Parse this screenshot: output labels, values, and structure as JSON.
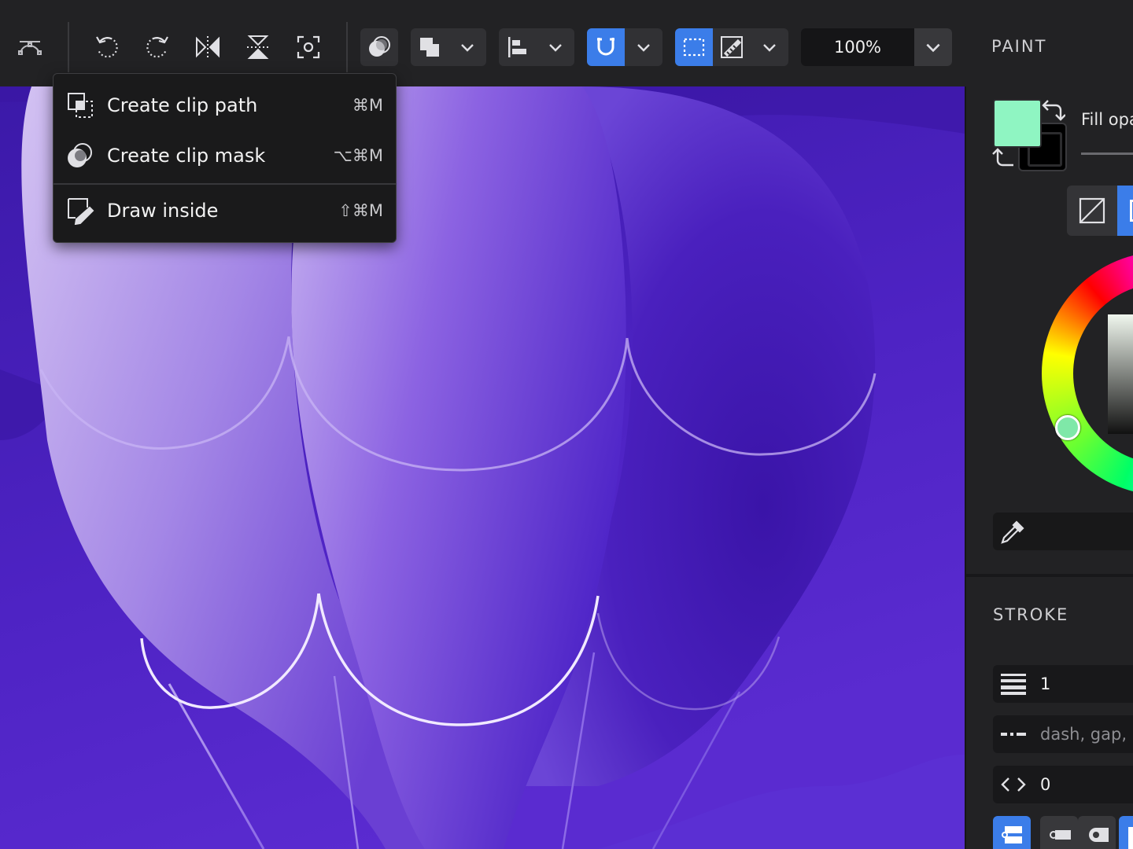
{
  "toolbar": {
    "zoom_value": "100%",
    "tools": [
      {
        "name": "node-tool-icon"
      },
      {
        "name": "undo-icon"
      },
      {
        "name": "redo-icon"
      },
      {
        "name": "flip-horizontal-icon"
      },
      {
        "name": "flip-vertical-icon"
      },
      {
        "name": "focus-icon"
      }
    ],
    "accent_color": "#3b7de9"
  },
  "clip_menu": {
    "items": [
      {
        "label": "Create clip path",
        "shortcut": "⌘M",
        "icon": "clip-path-icon"
      },
      {
        "label": "Create clip mask",
        "shortcut": "⌥⌘M",
        "icon": "clip-mask-icon"
      },
      {
        "label": "Draw inside",
        "shortcut": "⇧⌘M",
        "icon": "draw-inside-icon"
      }
    ]
  },
  "paint_panel": {
    "title": "PAINT",
    "fill_opacity_label": "Fill opa",
    "fill_color": "#8ff5c2",
    "stroke_color": "#000000"
  },
  "stroke_panel": {
    "title": "STROKE",
    "width_value": "1",
    "dash_placeholder": "dash, gap, ...",
    "offset_value": "0"
  },
  "canvas": {
    "background_color": "#4b22b8",
    "artwork_colors": [
      "#c9b3ef",
      "#9a76e6",
      "#5a2bcc",
      "#3a17a0"
    ]
  }
}
